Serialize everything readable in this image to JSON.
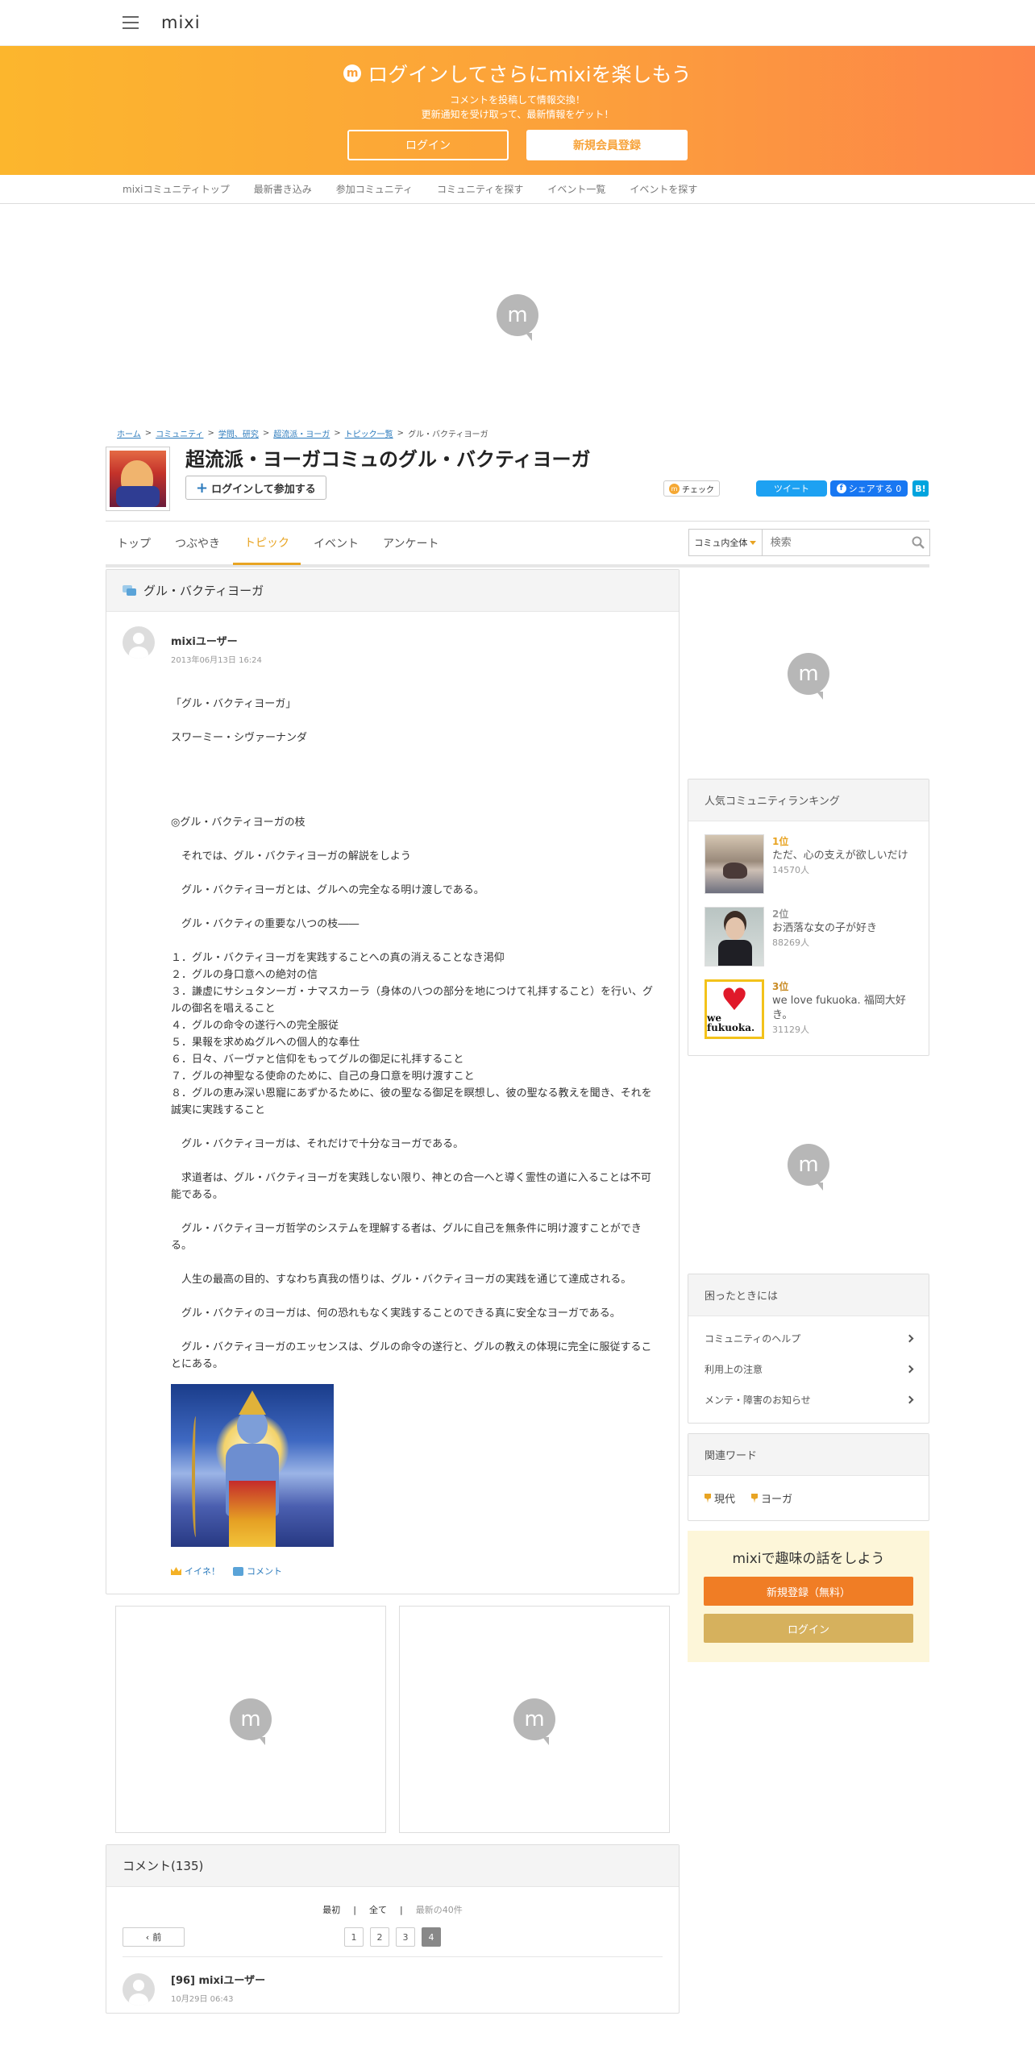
{
  "header": {
    "logo": "mixi"
  },
  "banner": {
    "title": "ログインしてさらにmixiを楽しもう",
    "line1": "コメントを投稿して情報交換！",
    "line2": "更新通知を受け取って、最新情報をゲット！",
    "login": "ログイン",
    "register": "新規会員登録"
  },
  "subnav": [
    "mixiコミュニティトップ",
    "最新書き込み",
    "参加コミュニティ",
    "コミュニティを探す",
    "イベント一覧",
    "イベントを探す"
  ],
  "breadcrumb": {
    "home": "ホーム",
    "community": "コミュニティ",
    "category": "学問、研究",
    "comm": "超流派・ヨーガ",
    "list": "トピック一覧",
    "current": "グル・バクティヨーガ",
    "sep": ">"
  },
  "community": {
    "title": "超流派・ヨーガコミュのグル・バクティヨーガ",
    "join": "ログインして参加する",
    "check": "チェック",
    "tweet": "ツイート",
    "share": "シェアする 0",
    "hatena": "B!"
  },
  "tabs": [
    "トップ",
    "つぶやき",
    "トピック",
    "イベント",
    "アンケート"
  ],
  "search": {
    "scope": "コミュ内全体",
    "placeholder": "検索"
  },
  "topic": {
    "title": "グル・バクティヨーガ",
    "user": "mixiユーザー",
    "date": "2013年06月13日 16:24",
    "body": "「グル・バクティヨーガ」\n\nスワーミー・シヴァーナンダ\n\n\n\n\n◎グル・バクティヨーガの枝\n\n　それでは、グル・バクティヨーガの解説をしよう\n\n　グル・バクティヨーガとは、グルへの完全なる明け渡しである。\n\n　グル・バクティの重要な八つの枝――\n\n１．グル・バクティヨーガを実践することへの真の消えることなき渇仰\n２．グルの身口意への絶対の信\n３．謙虚にサシュタンーガ・ナマスカーラ（身体の八つの部分を地につけて礼拝すること）を行い、グルの御名を唱えること\n４．グルの命令の遂行への完全服従\n５．果報を求めぬグルへの個人的な奉仕\n６．日々、バーヴァと信仰をもってグルの御足に礼拝すること\n７．グルの神聖なる使命のために、自己の身口意を明け渡すこと\n８．グルの恵み深い恩寵にあずかるために、彼の聖なる御足を瞑想し、彼の聖なる教えを聞き、それを誠実に実践すること\n\n　グル・バクティヨーガは、それだけで十分なヨーガである。\n\n　求道者は、グル・バクティヨーガを実践しない限り、神との合一へと導く霊性の道に入ることは不可能である。\n\n　グル・バクティヨーガ哲学のシステムを理解する者は、グルに自己を無条件に明け渡すことができる。\n\n　人生の最高の目的、すなわち真我の悟りは、グル・バクティヨーガの実践を通じて達成される。\n\n　グル・バクティのヨーガは、何の恐れもなく実践することのできる真に安全なヨーガである。\n\n　グル・バクティヨーガのエッセンスは、グルの命令の遂行と、グルの教えの体現に完全に服従することにある。",
    "like": "イイネ！",
    "comment": "コメント"
  },
  "comments": {
    "title": "コメント(135)",
    "first": "最初",
    "all": "全て",
    "latest": "最新の40件",
    "prev": "前",
    "pages": [
      "1",
      "2",
      "3",
      "4"
    ],
    "current_page": "4",
    "item": {
      "user": "[96] mixiユーザー",
      "date": "10月29日 06:43"
    }
  },
  "sidebar": {
    "ranking_title": "人気コミュニティランキング",
    "ranking": [
      {
        "rank": "1位",
        "name": "ただ、心の支えが欲しいだけ",
        "count": "14570人"
      },
      {
        "rank": "2位",
        "name": "お洒落な女の子が好き",
        "count": "88269人"
      },
      {
        "rank": "3位",
        "name": "we love fukuoka. 福岡大好き。",
        "count": "31129人"
      }
    ],
    "rank3_logo_text": "we fukuoka.",
    "help_title": "困ったときには",
    "help_links": [
      "コミュニティのヘルプ",
      "利用上の注意",
      "メンテ・障害のお知らせ"
    ],
    "words_title": "関連ワード",
    "words": [
      "現代",
      "ヨーガ"
    ],
    "promo_title": "mixiで趣味の話をしよう",
    "promo_register": "新規登録（無料）",
    "promo_login": "ログイン"
  },
  "colors": {
    "accent": "#e8a423",
    "banner_start": "#fcb62d",
    "banner_end": "#fd8449",
    "link": "#2c7bbd"
  }
}
